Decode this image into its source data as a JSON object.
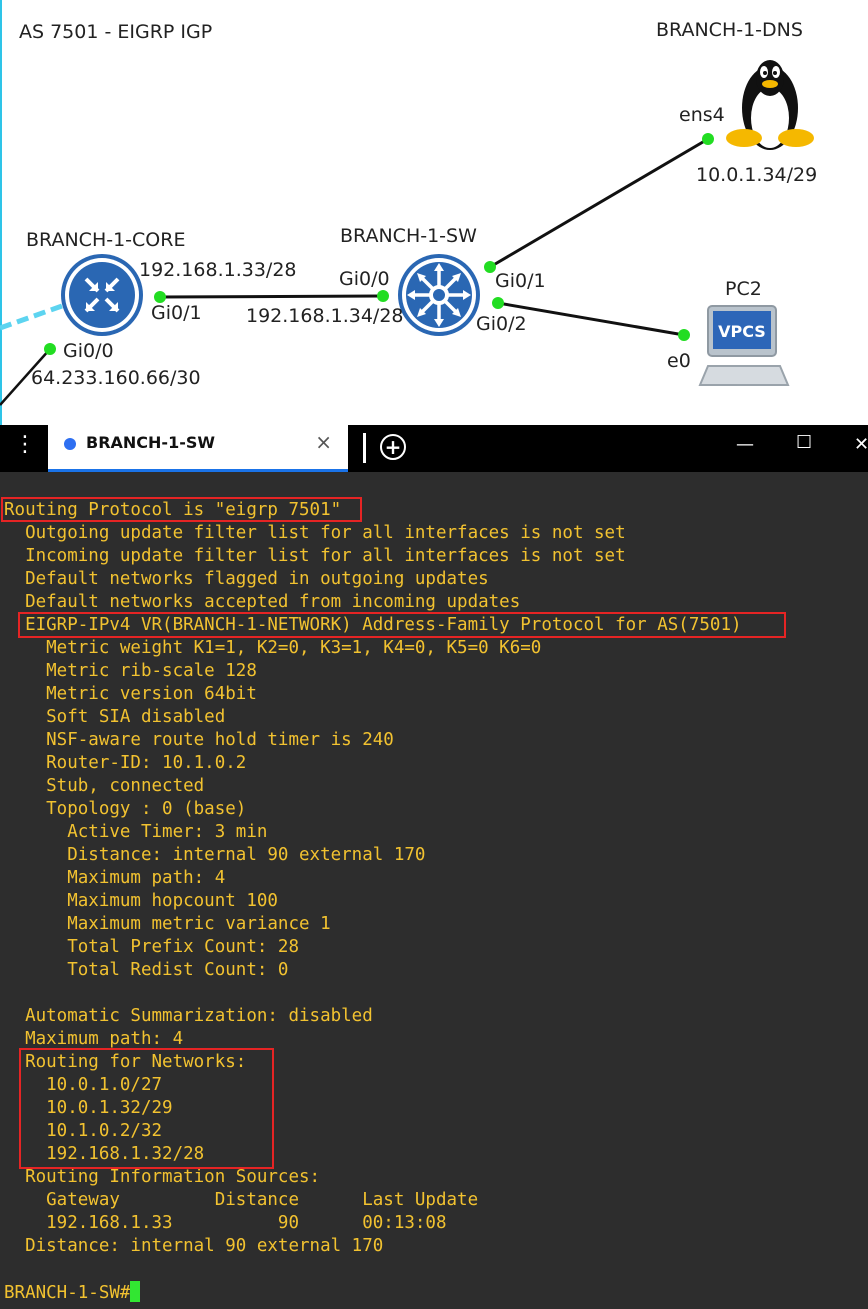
{
  "topology": {
    "title": "AS 7501 - EIGRP IGP",
    "nodes": {
      "branch_core": {
        "name": "BRANCH-1-CORE"
      },
      "branch_sw": {
        "name": "BRANCH-1-SW"
      },
      "branch_dns": {
        "name": "BRANCH-1-DNS"
      },
      "pc2": {
        "name": "PC2",
        "icon_text": "VPCS"
      }
    },
    "labels": {
      "core_gi01_ip": "192.168.1.33/28",
      "core_gi01": "Gi0/1",
      "core_gi00": "Gi0/0",
      "core_gi00_ip": "64.233.160.66/30",
      "sw_gi00": "Gi0/0",
      "sw_gi00_ip": "192.168.1.34/28",
      "sw_gi01": "Gi0/1",
      "sw_gi02": "Gi0/2",
      "dns_ens4": "ens4",
      "dns_ip": "10.0.1.34/29",
      "pc2_e0": "e0"
    }
  },
  "tabbar": {
    "tab_label": "BRANCH-1-SW",
    "close": "×",
    "add": "+",
    "minimize": "—",
    "maximize": "☐",
    "window_close": "✕"
  },
  "terminal": {
    "lines": [
      "Routing Protocol is \"eigrp 7501\"",
      "  Outgoing update filter list for all interfaces is not set",
      "  Incoming update filter list for all interfaces is not set",
      "  Default networks flagged in outgoing updates",
      "  Default networks accepted from incoming updates",
      "  EIGRP-IPv4 VR(BRANCH-1-NETWORK) Address-Family Protocol for AS(7501)",
      "    Metric weight K1=1, K2=0, K3=1, K4=0, K5=0 K6=0",
      "    Metric rib-scale 128",
      "    Metric version 64bit",
      "    Soft SIA disabled",
      "    NSF-aware route hold timer is 240",
      "    Router-ID: 10.1.0.2",
      "    Stub, connected",
      "    Topology : 0 (base)",
      "      Active Timer: 3 min",
      "      Distance: internal 90 external 170",
      "      Maximum path: 4",
      "      Maximum hopcount 100",
      "      Maximum metric variance 1",
      "      Total Prefix Count: 28",
      "      Total Redist Count: 0",
      "",
      "  Automatic Summarization: disabled",
      "  Maximum path: 4",
      "  Routing for Networks:",
      "    10.0.1.0/27",
      "    10.0.1.32/29",
      "    10.1.0.2/32",
      "    192.168.1.32/28",
      "  Routing Information Sources:",
      "    Gateway         Distance      Last Update",
      "    192.168.1.33          90      00:13:08",
      "  Distance: internal 90 external 170",
      "",
      "BRANCH-1-SW#"
    ]
  },
  "colors": {
    "terminal_bg": "#2d2d2d",
    "terminal_text": "#f2c230",
    "highlight_box": "#e52424",
    "cursor": "#32e632",
    "link_dot": "#22dd22",
    "device_blue": "#2a67b3"
  }
}
